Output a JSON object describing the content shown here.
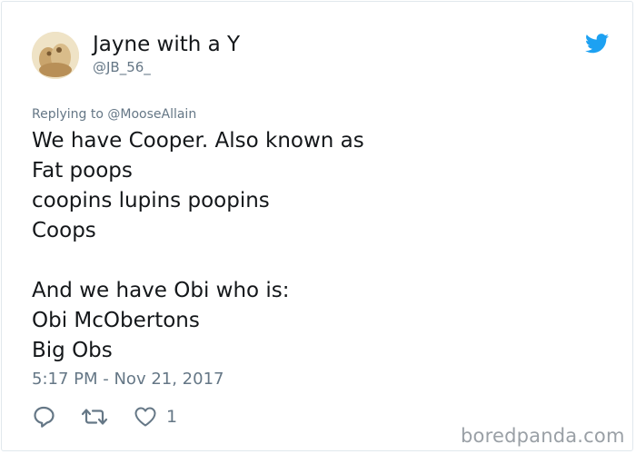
{
  "user": {
    "display_name": "Jayne with a Y",
    "handle": "@JB_56_"
  },
  "tweet": {
    "replying_to": "Replying to @MooseAllain",
    "lines": [
      "We have Cooper. Also known as",
      "Fat poops",
      "coopins lupins poopins",
      "Coops",
      "",
      "And we have Obi who is:",
      "Obi McObertons",
      "Big Obs"
    ],
    "timestamp": "5:17 PM - Nov 21, 2017"
  },
  "actions": {
    "like_count": "1"
  },
  "icons": {
    "brand": "twitter-bird-icon",
    "reply": "reply-icon",
    "retweet": "retweet-icon",
    "like": "heart-icon"
  },
  "colors": {
    "twitter_blue": "#1da1f2",
    "text": "#14171a",
    "muted": "#657786"
  },
  "watermark": "boredpanda.com"
}
